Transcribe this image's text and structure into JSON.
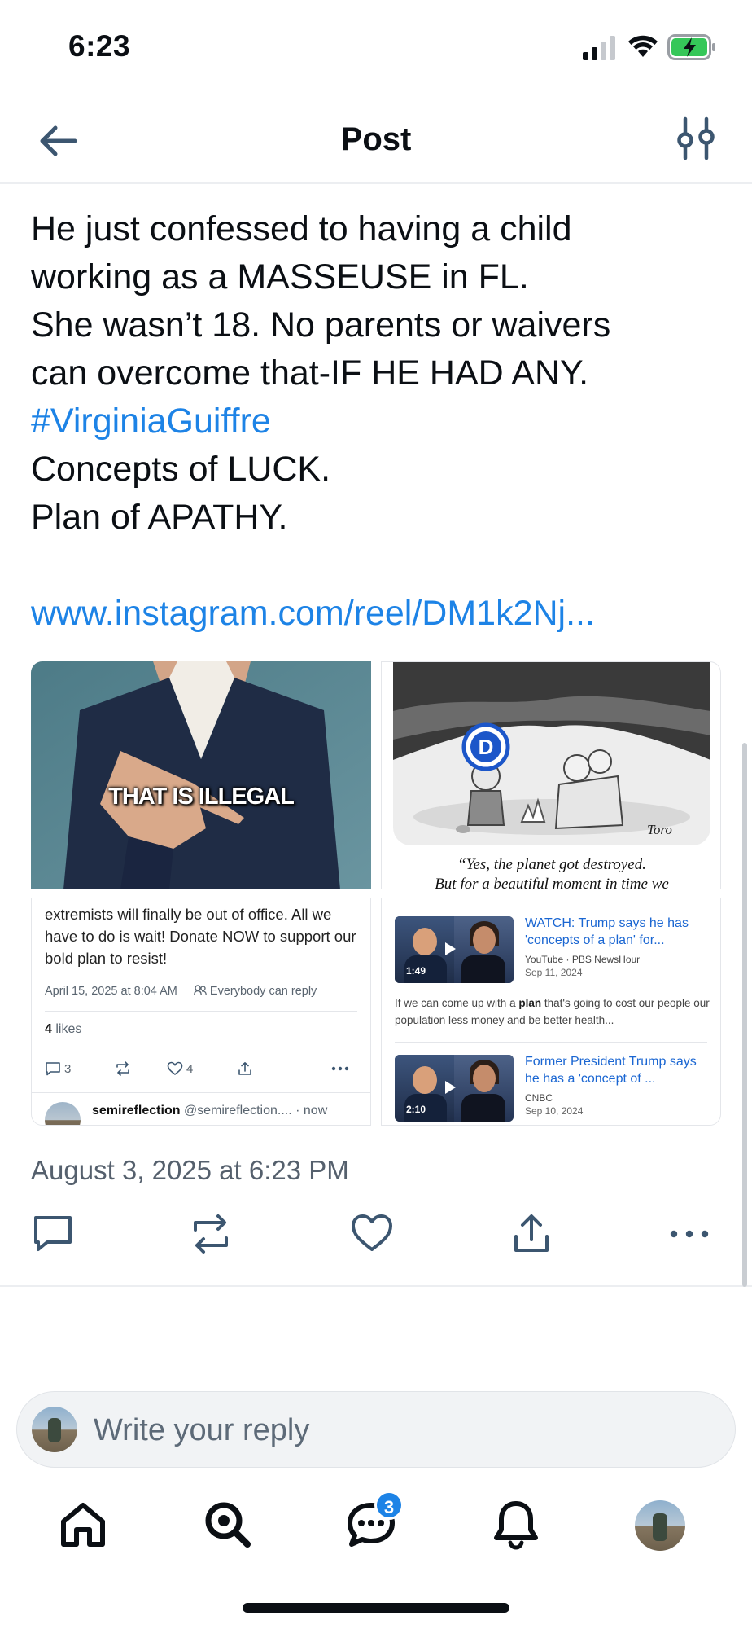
{
  "status_bar": {
    "time": "6:23"
  },
  "header": {
    "title": "Post"
  },
  "post": {
    "lines": [
      "He just confessed to having a child",
      "working as a MASSEUSE in FL.",
      "She wasn’t 18. No parents or waivers",
      "can overcome that-IF HE HAD ANY."
    ],
    "hashtag": "#VirginiaGuiffre",
    "lines_after": [
      "Concepts of LUCK.",
      "Plan of APATHY."
    ],
    "link": "www.instagram.com/reel/DM1k2Nj..."
  },
  "images": {
    "top_left_caption": "THAT IS ILLEGAL",
    "top_right_caption": "“Yes, the planet got destroyed.",
    "top_right_caption_2": "But for a beautiful moment in time we",
    "top_right_badge": "D",
    "top_right_signature": "Toro",
    "bottom_left": {
      "text": "extremists will finally be out of office. All we have to do is wait! Donate NOW to support our bold plan to resist!",
      "date": "April 15, 2025 at 8:04 AM",
      "reply_setting": "Everybody can reply",
      "likes_count": "4",
      "likes_label": "likes",
      "reply_count": "3",
      "like_count": "4",
      "username": "semireflection",
      "handle": "@semireflection....",
      "time": "· now"
    },
    "bottom_right": {
      "videos": [
        {
          "title": "WATCH: Trump says he has 'concepts of a plan' for...",
          "source": "YouTube · PBS NewsHour",
          "date": "Sep 11, 2024",
          "duration": "1:49"
        },
        {
          "title": "Former President Trump says he has a 'concept of ...",
          "source": "CNBC",
          "date": "Sep 10, 2024",
          "duration": "2:10"
        }
      ],
      "snippet_pre": "If we can come up with a ",
      "snippet_bold": "plan",
      "snippet_post": " that's going to cost our people our population less money and be better health..."
    }
  },
  "timestamp": "August 3, 2025 at 6:23 PM",
  "reply": {
    "placeholder": "Write your reply"
  },
  "nav": {
    "chat_badge": "3"
  },
  "colors": {
    "accent": "#1d83e6",
    "text": "#0b0f14",
    "muted": "#55606d"
  }
}
